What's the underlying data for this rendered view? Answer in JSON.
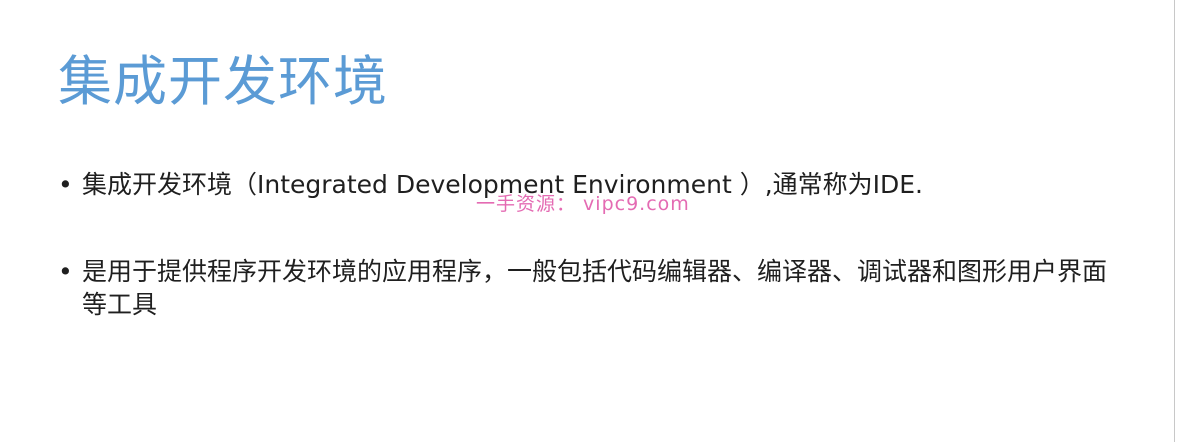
{
  "slide": {
    "title": "集成开发环境",
    "bullets": [
      {
        "marker": "•",
        "text": "集成开发环境（Integrated Development Environment ）,通常称为IDE."
      },
      {
        "marker": "•",
        "text": "是用于提供程序开发环境的应用程序，一般包括代码编辑器、编译器、调试器和图形用户界面等工具"
      }
    ],
    "watermark": "一手资源：  vipc9.com"
  },
  "colors": {
    "title": "#5b9bd5",
    "body_text": "#1f1f1f",
    "watermark": "#e46bb3",
    "background": "#ffffff"
  }
}
